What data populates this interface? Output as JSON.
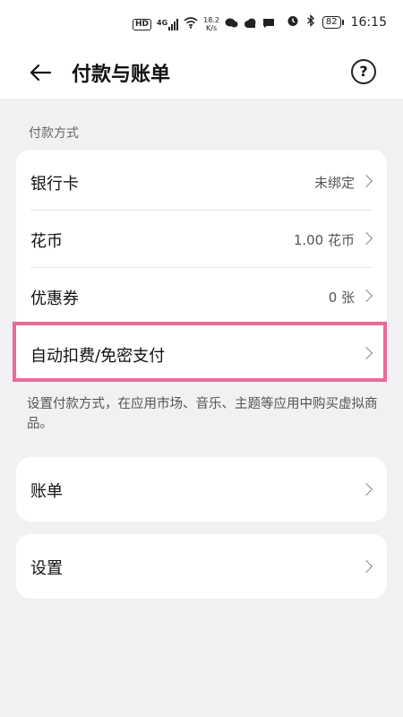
{
  "status_bar": {
    "hd": "HD",
    "signal_type": "4G",
    "speed_value": "18.2",
    "speed_unit": "K/s",
    "battery": "82",
    "time": "16:15"
  },
  "header": {
    "title": "付款与账单"
  },
  "payment_section": {
    "label": "付款方式",
    "items": [
      {
        "label": "银行卡",
        "value": "未绑定"
      },
      {
        "label": "花币",
        "value": "1.00 花币"
      },
      {
        "label": "优惠券",
        "value": "0 张"
      },
      {
        "label": "自动扣费/免密支付",
        "value": ""
      }
    ],
    "description": "设置付款方式，在应用市场、音乐、主题等应用中购买虚拟商品。"
  },
  "bills": {
    "label": "账单"
  },
  "settings": {
    "label": "设置"
  },
  "colors": {
    "highlight": "#e96b9a",
    "background": "#f1f1f3",
    "card": "#ffffff"
  }
}
